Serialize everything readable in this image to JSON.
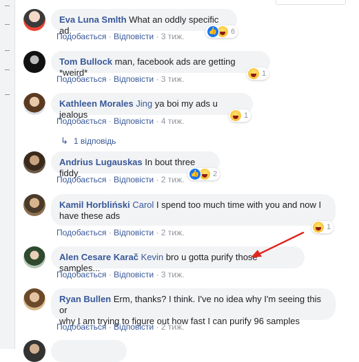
{
  "labels": {
    "like": "Подобається",
    "reply": "Відповісти",
    "sep": " · "
  },
  "comments": [
    {
      "author": "Eva Luna Smlth",
      "text": "What an oddly specific ad.",
      "time": "3 тиж.",
      "reactions": "6"
    },
    {
      "author": "Tom Bullock",
      "text": "man, facebook ads are getting *weird*",
      "time": "3 тиж.",
      "reactions": "1"
    },
    {
      "author": "Kathleen Morales",
      "mention": "Jing",
      "text": "ya boi my ads u jealous",
      "time": "4 тиж.",
      "reactions": "1"
    },
    {
      "author": "Andrius Lugauskas",
      "text": "In bout three fiddy",
      "time": "2 тиж.",
      "reactions": "2"
    },
    {
      "author": "Kamil Horbliński",
      "mention": "Carol",
      "text_line1": "I spend too much time with you and now I",
      "text_line2": "have these ads",
      "time": "2 тиж.",
      "reactions": "1"
    },
    {
      "author": "Alen Cesare Karač",
      "mention": "Kevin",
      "text": "bro u gotta purify those samples...",
      "time": "3 тиж."
    },
    {
      "author": "Ryan Bullen",
      "text_line1": "Erm, thanks? I think. I've no idea why I'm seeing this or",
      "text_line2": "why I am trying to figure out how fast I can purify 96 samples",
      "time": "2 тиж."
    }
  ],
  "replies_link": "1 відповідь",
  "colors": {
    "link": "#385898",
    "bubble": "#f2f3f5",
    "meta": "#90949c",
    "annotation_arrow": "#e0281e"
  }
}
